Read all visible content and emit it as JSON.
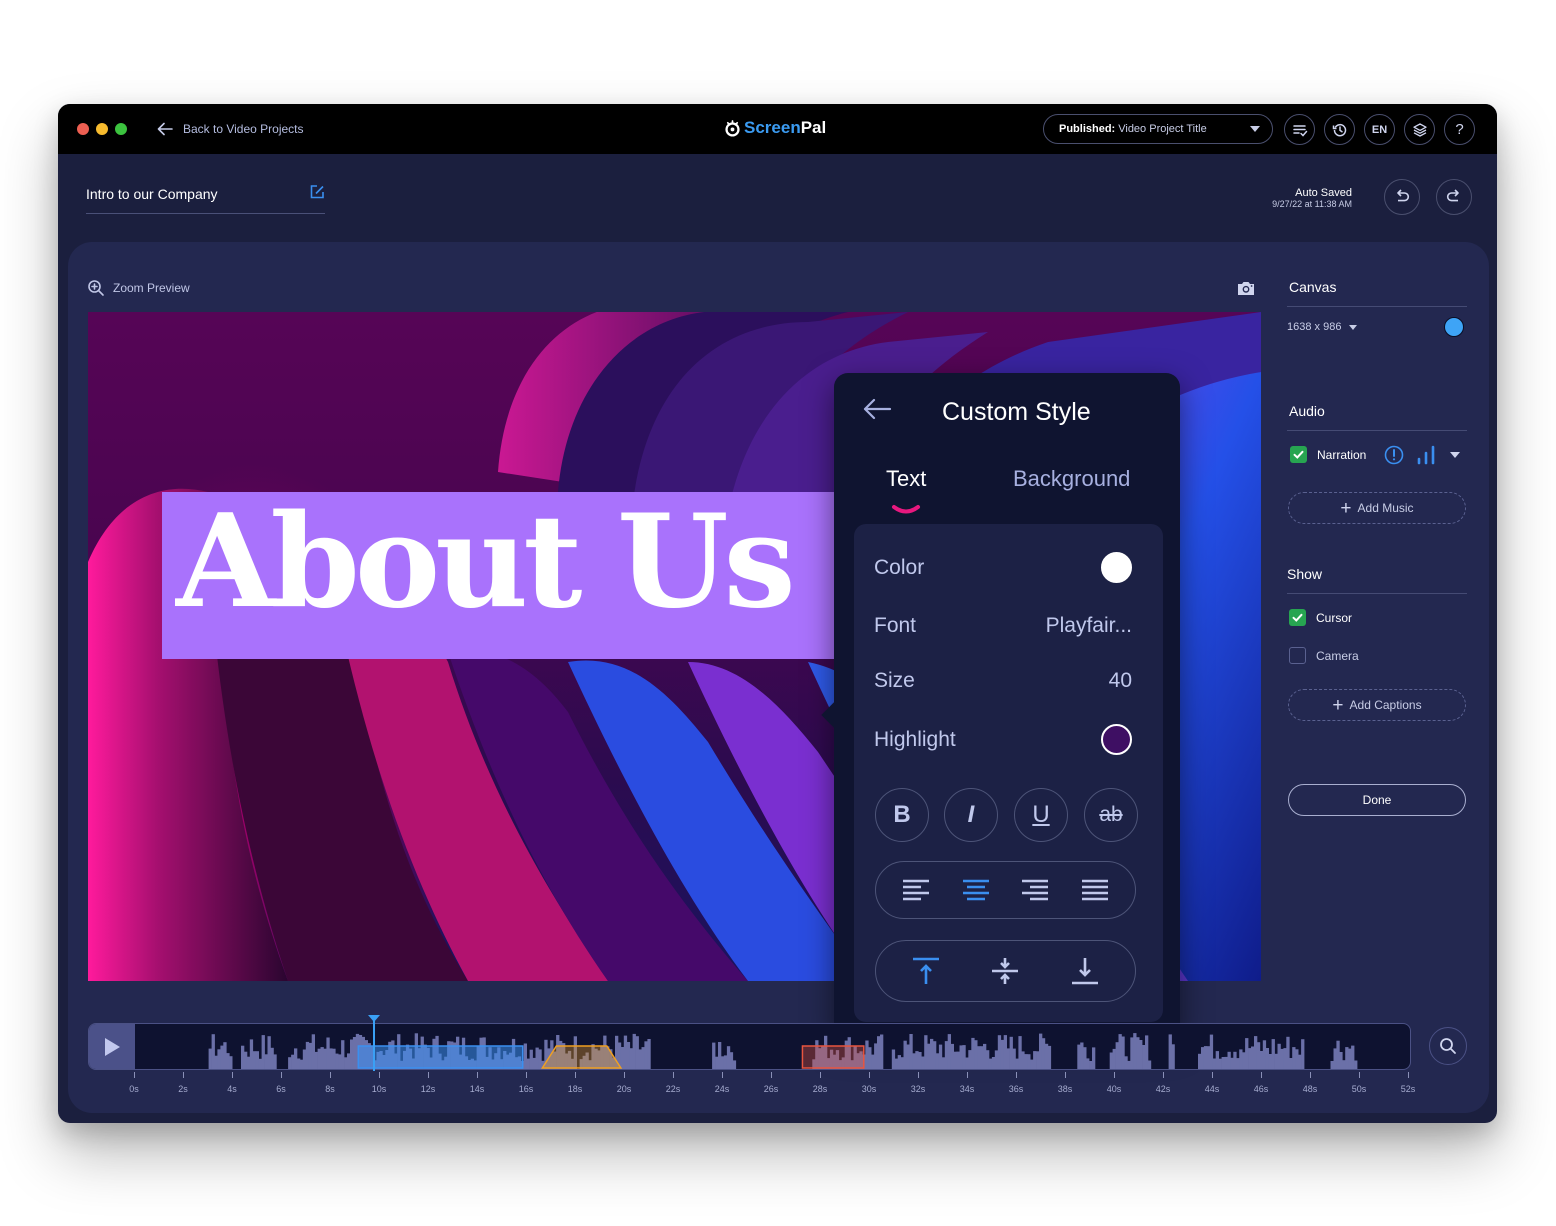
{
  "titlebar": {
    "back_label": "Back to Video Projects",
    "logo": {
      "screen": "Screen",
      "pal": "Pal",
      "icon": "screenpal-logo-icon"
    },
    "publish": {
      "prefix": "Published:",
      "value": "Video Project Title"
    },
    "icons": [
      "checklist-icon",
      "history-icon",
      "language-icon",
      "layers-icon",
      "help-icon"
    ],
    "language": "EN",
    "help": "?"
  },
  "project": {
    "title": "Intro to our Company",
    "autosave_label": "Auto Saved",
    "autosave_time": "9/27/22 at 11:38 AM"
  },
  "preview": {
    "zoom_label": "Zoom Preview",
    "overlay_text": "About Us",
    "overlay_bg_color": "#a972fc",
    "overlay_text_color": "#ffffff"
  },
  "custom_style": {
    "title": "Custom Style",
    "tabs": [
      {
        "label": "Text",
        "active": true
      },
      {
        "label": "Background",
        "active": false
      }
    ],
    "properties": {
      "color": {
        "label": "Color",
        "value": "#ffffff"
      },
      "font": {
        "label": "Font",
        "value": "Playfair..."
      },
      "size": {
        "label": "Size",
        "value": "40"
      },
      "highlight": {
        "label": "Highlight",
        "value": "#3e0f63"
      }
    },
    "format_buttons": [
      {
        "name": "bold",
        "glyph": "B"
      },
      {
        "name": "italic",
        "glyph": "I"
      },
      {
        "name": "underline",
        "glyph": "U"
      },
      {
        "name": "strikethrough",
        "glyph": "ab"
      }
    ],
    "text_align": {
      "options": [
        "left",
        "center",
        "right",
        "justify"
      ],
      "selected": "center"
    },
    "vertical_align": {
      "options": [
        "top",
        "middle",
        "bottom"
      ],
      "selected": "top"
    },
    "accent_color": "#3a8ff0",
    "tab_indicator_color": "#e8187f"
  },
  "sidebar": {
    "canvas": {
      "heading": "Canvas",
      "size": "1638 x 986",
      "color": "#3ea4f6"
    },
    "audio": {
      "heading": "Audio",
      "narration_label": "Narration",
      "narration_checked": true,
      "add_music_label": "Add Music"
    },
    "show": {
      "heading": "Show",
      "cursor_label": "Cursor",
      "cursor_checked": true,
      "camera_label": "Camera",
      "camera_checked": false,
      "add_captions_label": "Add Captions"
    },
    "done_label": "Done"
  },
  "timeline": {
    "tick_labels": [
      "0s",
      "2s",
      "4s",
      "6s",
      "8s",
      "10s",
      "12s",
      "14s",
      "16s",
      "18s",
      "20s",
      "22s",
      "24s",
      "26s",
      "28s",
      "30s",
      "32s",
      "34s",
      "36s",
      "38s",
      "40s",
      "42s",
      "44s",
      "46s",
      "48s",
      "50s",
      "52s"
    ],
    "playhead_seconds": 9.8,
    "duration_seconds": 52,
    "segments": [
      {
        "type": "selection",
        "start": 9.1,
        "end": 15.8,
        "color": "#3a8ff0"
      },
      {
        "type": "transition",
        "start": 16.6,
        "end": 19.8,
        "color": "#f0a020"
      },
      {
        "type": "cut",
        "start": 27.2,
        "end": 29.7,
        "color": "#e8553f"
      }
    ]
  }
}
